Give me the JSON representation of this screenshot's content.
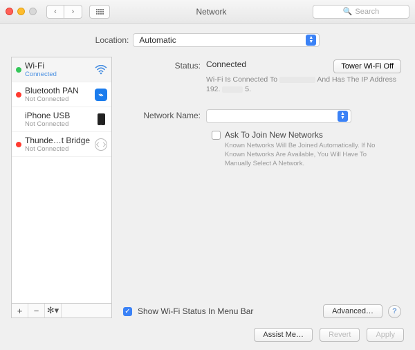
{
  "window": {
    "title": "Network",
    "search_placeholder": "Search"
  },
  "location": {
    "label": "Location:",
    "value": "Automatic"
  },
  "services": [
    {
      "name": "Wi-Fi",
      "status": "Connected",
      "dot": "green",
      "icon": "wifi"
    },
    {
      "name": "Bluetooth PAN",
      "status": "Not Connected",
      "dot": "red",
      "icon": "bluetooth"
    },
    {
      "name": "iPhone USB",
      "status": "Not Connected",
      "dot": "none",
      "icon": "phone"
    },
    {
      "name": "Thunde…t Bridge",
      "status": "Not Connected",
      "dot": "red",
      "icon": "thunderbolt"
    }
  ],
  "details": {
    "status_label": "Status:",
    "status_value": "Connected",
    "wifi_off_button": "Tower Wi-Fi Off",
    "substatus_prefix": "Wi-Fi Is Connected To",
    "substatus_mid": "And Has The IP Address 192.",
    "substatus_suffix": "5.",
    "network_name_label": "Network Name:",
    "network_name_value": "",
    "ask_label": "Ask To Join New Networks",
    "ask_desc": "Known Networks Will Be Joined Automatically. If No Known Networks Are Available, You Will Have To Manually Select A Network.",
    "menubar_label": "Show Wi-Fi Status In Menu Bar",
    "advanced_button": "Advanced…"
  },
  "footer": {
    "assist": "Assist Me…",
    "revert": "Revert",
    "apply": "Apply"
  }
}
